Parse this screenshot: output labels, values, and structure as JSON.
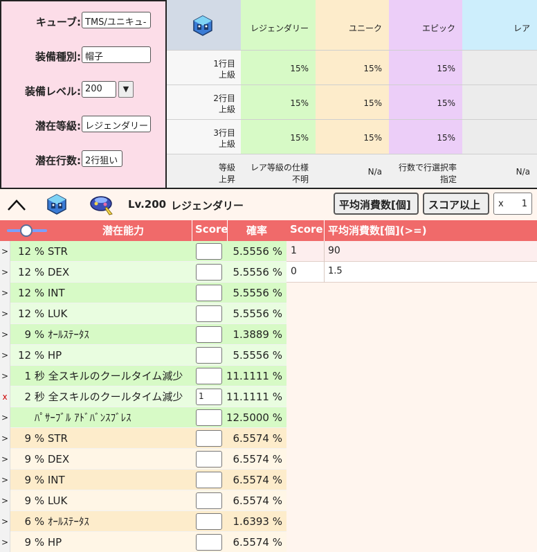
{
  "form": {
    "cube_label": "キューブ:",
    "cube_value": "TMS/ユニキュ-",
    "type_label": "装備種別:",
    "type_value": "帽子",
    "level_label": "装備レベル:",
    "level_value": "200",
    "level_dropdown": "▼",
    "grade_label": "潜在等級:",
    "grade_value": "レジェンダリー",
    "lines_label": "潜在行数:",
    "lines_value": "2行狙い"
  },
  "prob_table": {
    "headers": [
      "レジェンダリー",
      "ユニーク",
      "エピック",
      "レア"
    ],
    "rows": [
      {
        "label1": "1行目",
        "label2": "上級",
        "values": [
          "15%",
          "15%",
          "15%",
          ""
        ]
      },
      {
        "label1": "2行目",
        "label2": "上級",
        "values": [
          "15%",
          "15%",
          "15%",
          ""
        ]
      },
      {
        "label1": "3行目",
        "label2": "上級",
        "values": [
          "15%",
          "15%",
          "15%",
          ""
        ]
      }
    ],
    "upgrade": {
      "label1": "等級",
      "label2": "上昇",
      "legend1": "レア等級の仕様",
      "legend2": "不明",
      "unique": "N/a",
      "epic1": "行数で行選択率",
      "epic2": "指定",
      "rare": "N/a"
    }
  },
  "toolbar": {
    "collapse_icon": "^",
    "level_text": "Lv.200",
    "grade_text": "レジェンダリー",
    "avg_button": "平均消費数[個]",
    "score_button": "スコア以上",
    "x_label": "x",
    "x_value": "1"
  },
  "list": {
    "header_name": "潜在能力",
    "header_score": "Score",
    "header_prob": "確率",
    "rows": [
      {
        "mark": ">",
        "name": "12 % STR",
        "score": "",
        "prob": "5.5556 %"
      },
      {
        "mark": ">",
        "name": "12 % DEX",
        "score": "",
        "prob": "5.5556 %"
      },
      {
        "mark": ">",
        "name": "12 % INT",
        "score": "",
        "prob": "5.5556 %"
      },
      {
        "mark": ">",
        "name": "12 % LUK",
        "score": "",
        "prob": "5.5556 %"
      },
      {
        "mark": ">",
        "name": "  9 % ｵｰﾙｽﾃｰﾀｽ",
        "score": "",
        "prob": "1.3889 %"
      },
      {
        "mark": ">",
        "name": "12 % HP",
        "score": "",
        "prob": "5.5556 %"
      },
      {
        "mark": ">",
        "name": "  1 秒 全スキルのクールタイム減少",
        "score": "",
        "prob": "11.1111 %"
      },
      {
        "mark": "x",
        "name": "  2 秒 全スキルのクールタイム減少",
        "score": "1",
        "prob": "11.1111 %"
      },
      {
        "mark": ">",
        "name": "     ﾊﾟｻｰﾌﾞﾙ ｱﾄﾞﾊﾞﾝｽﾌﾞﾚｽ",
        "score": "",
        "prob": "12.5000 %"
      },
      {
        "mark": ">",
        "name": "  9 % STR",
        "score": "",
        "prob": "6.5574 %"
      },
      {
        "mark": ">",
        "name": "  9 % DEX",
        "score": "",
        "prob": "6.5574 %"
      },
      {
        "mark": ">",
        "name": "  9 % INT",
        "score": "",
        "prob": "6.5574 %"
      },
      {
        "mark": ">",
        "name": "  9 % LUK",
        "score": "",
        "prob": "6.5574 %"
      },
      {
        "mark": ">",
        "name": "  6 % ｵｰﾙｽﾃｰﾀｽ",
        "score": "",
        "prob": "1.6393 %"
      },
      {
        "mark": ">",
        "name": "  9 % HP",
        "score": "",
        "prob": "6.5574 %"
      }
    ]
  },
  "score_table": {
    "header_score": "Score",
    "header_avg": "平均消費数[個](>=)",
    "rows": [
      {
        "score": "1",
        "avg": "90"
      },
      {
        "score": "0",
        "avg": "1.5"
      }
    ]
  },
  "colors": {
    "header_red": "#f06a6a",
    "legendary_green": "#d7fac6",
    "unique_cream": "#fdeccb",
    "epic_purple": "#eccef8",
    "rare_blue": "#cdeefc",
    "form_pink": "#fcdde8"
  }
}
